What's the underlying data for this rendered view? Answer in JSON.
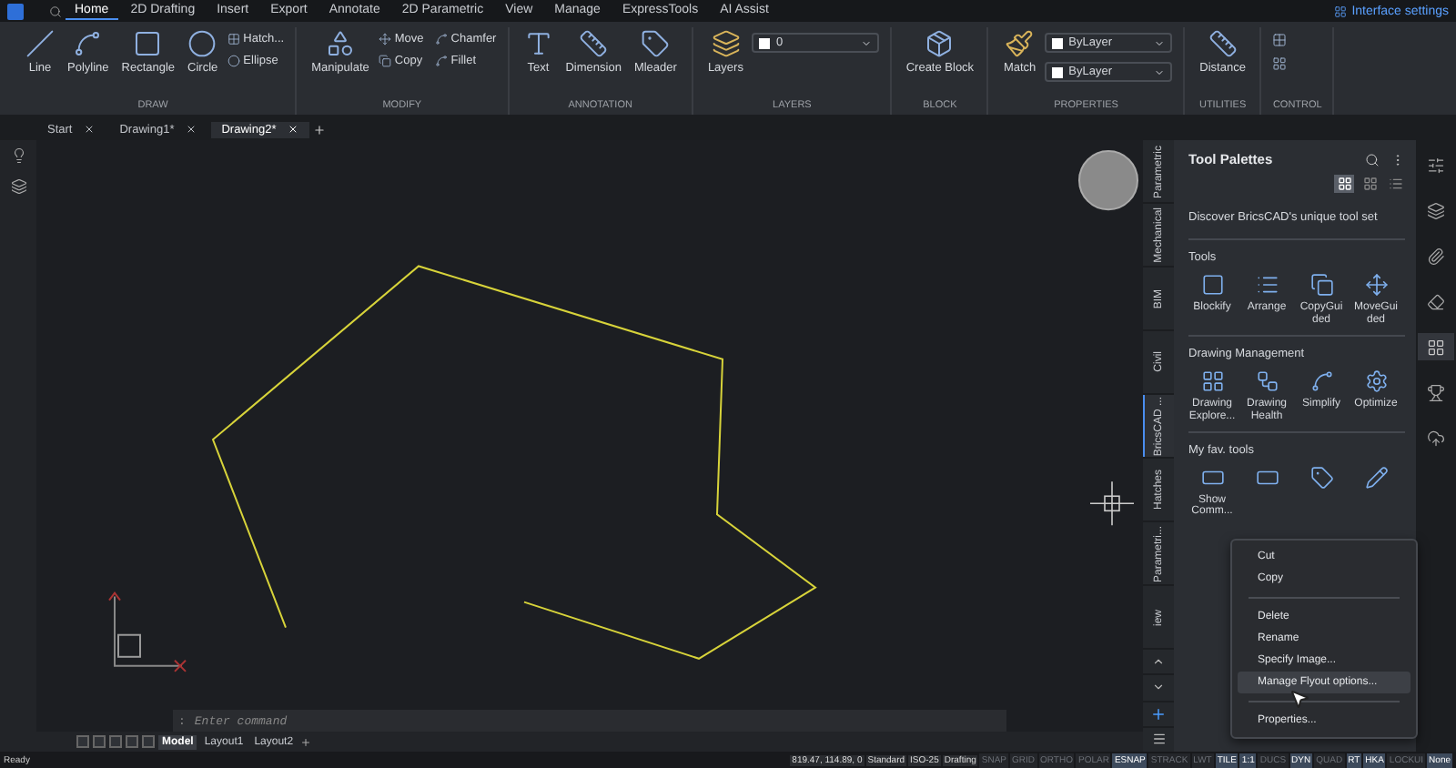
{
  "top_bar": {
    "tabs": [
      {
        "label": "Home",
        "selected": true
      },
      {
        "label": "2D Drafting",
        "selected": false
      },
      {
        "label": "Insert",
        "selected": false
      },
      {
        "label": "Export",
        "selected": false
      },
      {
        "label": "Annotate",
        "selected": false
      },
      {
        "label": "2D Parametric",
        "selected": false
      },
      {
        "label": "View",
        "selected": false
      },
      {
        "label": "Manage",
        "selected": false
      },
      {
        "label": "ExpressTools",
        "selected": false
      },
      {
        "label": "AI Assist",
        "selected": false
      }
    ],
    "interface_settings": "Interface settings"
  },
  "ribbon": {
    "groups": [
      {
        "title": "DRAW",
        "large": [
          "Line",
          "Polyline",
          "Rectangle",
          "Circle"
        ],
        "small": [
          "Hatch...",
          "Ellipse"
        ]
      },
      {
        "title": "MODIFY",
        "large": [
          "Manipulate"
        ],
        "small": [
          "Move",
          "Copy",
          "Chamfer",
          "Fillet"
        ]
      },
      {
        "title": "ANNOTATION",
        "large": [
          "Text",
          "Dimension",
          "Mleader"
        ]
      },
      {
        "title": "LAYERS",
        "large": [
          "Layers"
        ],
        "dropdowns": [
          "0"
        ]
      },
      {
        "title": "BLOCK",
        "large": [
          "Create Block"
        ]
      },
      {
        "title": "PROPERTIES",
        "large": [
          "Match"
        ],
        "dropdowns": [
          "ByLayer",
          "ByLayer"
        ]
      },
      {
        "title": "UTILITIES",
        "large": [
          "Distance"
        ]
      },
      {
        "title": "CONTROL"
      }
    ]
  },
  "document_tabs": [
    {
      "label": "Start",
      "selected": false
    },
    {
      "label": "Drawing1*",
      "selected": false
    },
    {
      "label": "Drawing2*",
      "selected": true
    }
  ],
  "palette_tabs": [
    {
      "label": "Parametric",
      "selected": false
    },
    {
      "label": "Mechanical",
      "selected": false
    },
    {
      "label": "BIM",
      "selected": false
    },
    {
      "label": "Civil",
      "selected": false
    },
    {
      "label": "BricsCAD ...",
      "selected": true
    },
    {
      "label": "Hatches",
      "selected": false
    },
    {
      "label": "Parametri...",
      "selected": false
    },
    {
      "label": "iew",
      "selected": false
    }
  ],
  "tool_palette": {
    "title": "Tool Palettes",
    "views": [
      {
        "selected": true
      },
      {
        "selected": false
      },
      {
        "selected": false
      }
    ],
    "intro": "Discover BricsCAD's unique tool set",
    "sections": [
      {
        "title": "Tools",
        "tools": [
          {
            "kind": "labeled",
            "label": "Blockify"
          },
          {
            "kind": "labeled",
            "label": "Arrange"
          },
          {
            "kind": "labeled",
            "label": "CopyGuided"
          },
          {
            "kind": "labeled",
            "label": "MoveGuided"
          }
        ]
      },
      {
        "title": "Drawing Management",
        "tools": [
          {
            "kind": "labeled",
            "label": "Drawing Explore..."
          },
          {
            "kind": "labeled",
            "label": "Drawing Health"
          },
          {
            "kind": "labeled",
            "label": "Simplify"
          },
          {
            "kind": "labeled",
            "label": "Optimize"
          }
        ]
      },
      {
        "title": "My fav. tools",
        "tools": [
          {
            "kind": "labeled",
            "label": "Show Comm..."
          },
          {
            "kind": "icon"
          },
          {
            "kind": "icon"
          },
          {
            "kind": "icon"
          }
        ]
      }
    ]
  },
  "context_menu": {
    "items": [
      {
        "kind": "item",
        "label": "Cut",
        "selected": false
      },
      {
        "kind": "item",
        "label": "Copy",
        "selected": false
      },
      {
        "kind": "separator"
      },
      {
        "kind": "item",
        "label": "Delete",
        "selected": false
      },
      {
        "kind": "item",
        "label": "Rename",
        "selected": false
      },
      {
        "kind": "item",
        "label": "Specify Image...",
        "selected": false
      },
      {
        "kind": "item",
        "label": "Manage Flyout options...",
        "selected": true
      },
      {
        "kind": "separator"
      },
      {
        "kind": "item",
        "label": "Properties...",
        "selected": false
      }
    ]
  },
  "command_line": {
    "prompt": ":",
    "placeholder": "Enter command"
  },
  "layout_tabs": [
    {
      "label": "Model",
      "selected": true
    },
    {
      "label": "Layout1",
      "selected": false
    },
    {
      "label": "Layout2",
      "selected": false
    }
  ],
  "status_bar": {
    "message": "Ready",
    "coordinates": "819.47, 114.89, 0",
    "styles": [
      "Standard",
      "ISO-25",
      "Drafting"
    ],
    "toggles": [
      {
        "label": "SNAP",
        "on": false
      },
      {
        "label": "GRID",
        "on": false
      },
      {
        "label": "ORTHO",
        "on": false
      },
      {
        "label": "POLAR",
        "on": false
      },
      {
        "label": "ESNAP",
        "on": true
      },
      {
        "label": "STRACK",
        "on": false
      },
      {
        "label": "LWT",
        "on": false
      },
      {
        "label": "TILE",
        "on": true
      },
      {
        "label": "1:1",
        "on": true
      },
      {
        "label": "DUCS",
        "on": false
      },
      {
        "label": "DYN",
        "on": true
      },
      {
        "label": "QUAD",
        "on": false
      },
      {
        "label": "RT",
        "on": true
      },
      {
        "label": "HKA",
        "on": true
      },
      {
        "label": "LOCKUI",
        "on": false
      },
      {
        "label": "None",
        "on": true
      }
    ]
  }
}
